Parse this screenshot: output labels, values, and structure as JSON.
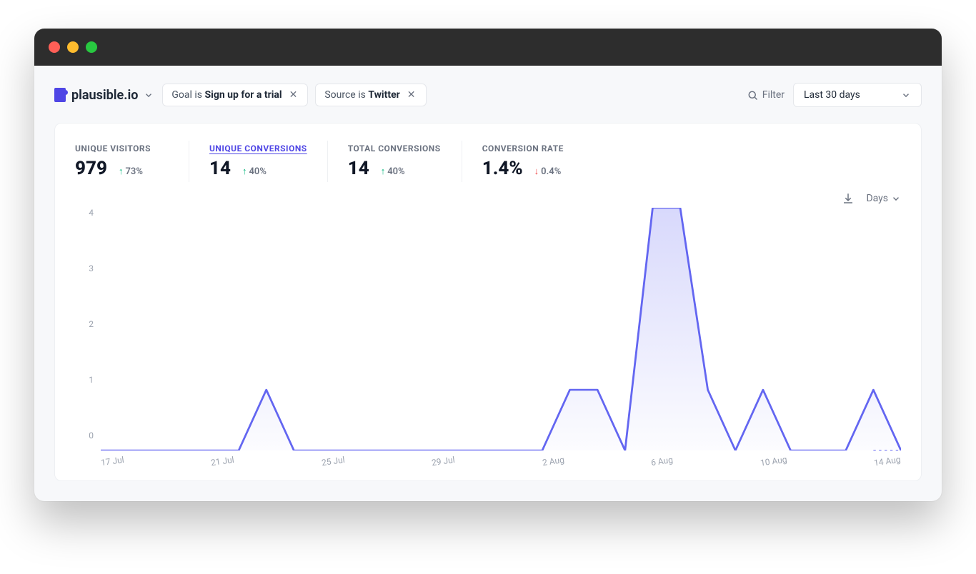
{
  "site_name": "plausible.io",
  "filters": [
    {
      "prefix": "Goal is ",
      "value": "Sign up for a trial"
    },
    {
      "prefix": "Source is ",
      "value": "Twitter"
    }
  ],
  "filter_label": "Filter",
  "date_range": "Last 30 days",
  "stats": [
    {
      "label": "UNIQUE VISITORS",
      "value": "979",
      "delta": "73%",
      "direction": "up",
      "active": false
    },
    {
      "label": "UNIQUE CONVERSIONS",
      "value": "14",
      "delta": "40%",
      "direction": "up",
      "active": true
    },
    {
      "label": "TOTAL CONVERSIONS",
      "value": "14",
      "delta": "40%",
      "direction": "up",
      "active": false
    },
    {
      "label": "CONVERSION RATE",
      "value": "1.4%",
      "delta": "0.4%",
      "direction": "down",
      "active": false
    }
  ],
  "interval_label": "Days",
  "chart_data": {
    "type": "line",
    "title": "",
    "xlabel": "",
    "ylabel": "",
    "ylim": [
      0,
      4
    ],
    "y_ticks": [
      "4",
      "3",
      "2",
      "1",
      "0"
    ],
    "x_tick_labels": [
      "17 Jul",
      "21 Jul",
      "25 Jul",
      "29 Jul",
      "2 Aug",
      "6 Aug",
      "10 Aug",
      "14 Aug"
    ],
    "categories": [
      "17 Jul",
      "18 Jul",
      "19 Jul",
      "20 Jul",
      "21 Jul",
      "22 Jul",
      "23 Jul",
      "24 Jul",
      "25 Jul",
      "26 Jul",
      "27 Jul",
      "28 Jul",
      "29 Jul",
      "30 Jul",
      "31 Jul",
      "1 Aug",
      "2 Aug",
      "3 Aug",
      "4 Aug",
      "5 Aug",
      "6 Aug",
      "7 Aug",
      "8 Aug",
      "9 Aug",
      "10 Aug",
      "11 Aug",
      "12 Aug",
      "13 Aug",
      "14 Aug",
      "15 Aug"
    ],
    "series": [
      {
        "name": "Unique conversions",
        "values": [
          0,
          0,
          0,
          0,
          0,
          0,
          1,
          0,
          0,
          0,
          0,
          0,
          0,
          0,
          0,
          0,
          0,
          1,
          1,
          0,
          4,
          4,
          1,
          0,
          1,
          0,
          0,
          0,
          1,
          0
        ]
      }
    ],
    "colors": {
      "line": "#6366f1",
      "fill_top": "rgba(99,102,241,0.25)",
      "fill_bottom": "rgba(99,102,241,0.02)"
    }
  }
}
